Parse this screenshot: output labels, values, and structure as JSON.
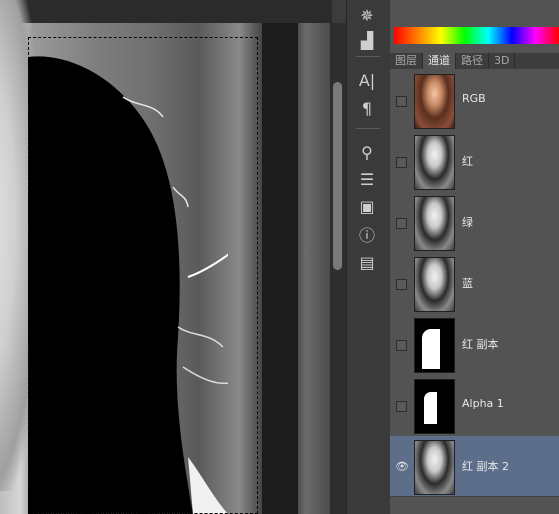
{
  "panel": {
    "tabs": [
      {
        "label": "图层",
        "active": false
      },
      {
        "label": "通道",
        "active": true
      },
      {
        "label": "路径",
        "active": false
      },
      {
        "label": "3D",
        "active": false
      }
    ],
    "channels": [
      {
        "label": "RGB",
        "visible": false,
        "selected": false,
        "thumb": "color-photo"
      },
      {
        "label": "红",
        "visible": false,
        "selected": false,
        "thumb": "grayscale-photo"
      },
      {
        "label": "绿",
        "visible": false,
        "selected": false,
        "thumb": "grayscale-photo"
      },
      {
        "label": "蓝",
        "visible": false,
        "selected": false,
        "thumb": "grayscale-photo"
      },
      {
        "label": "红 副本",
        "visible": false,
        "selected": false,
        "thumb": "mask-white-shape"
      },
      {
        "label": "Alpha 1",
        "visible": false,
        "selected": false,
        "thumb": "mask-white-shape"
      },
      {
        "label": "红 副本 2",
        "visible": true,
        "selected": true,
        "thumb": "grayscale-photo-masked"
      }
    ]
  },
  "dock": {
    "icons": [
      "compass-icon",
      "histogram-icon",
      "character-icon",
      "paragraph-icon",
      "brushes-icon",
      "adjustments-icon",
      "tool-presets-icon",
      "info-icon",
      "notes-icon"
    ]
  },
  "colors": {
    "panel_bg": "#535353",
    "selected_row": "#5d6e8a",
    "dock_bg": "#3a3a3a"
  }
}
